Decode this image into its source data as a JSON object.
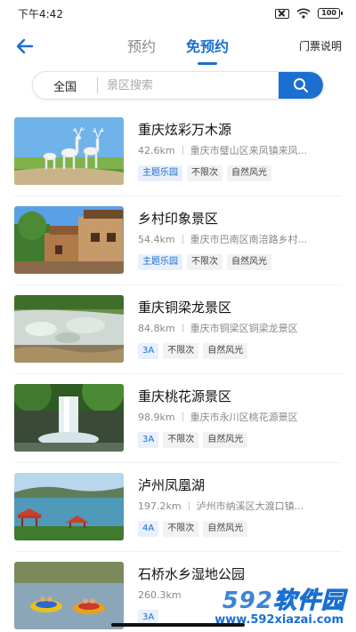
{
  "status_bar": {
    "time": "下午4:42",
    "battery": "100"
  },
  "nav": {
    "tabs": [
      {
        "label": "预约",
        "active": false
      },
      {
        "label": "免预约",
        "active": true
      }
    ],
    "ticket_info": "门票说明"
  },
  "search": {
    "region": "全国",
    "placeholder": "景区搜索"
  },
  "spots": [
    {
      "name": "重庆炫彩万木源",
      "distance": "42.6km",
      "address": "重庆市璧山区来凤镇来凤...",
      "tags": [
        "主题乐园",
        "不限次",
        "自然风光"
      ],
      "image": "deer-sculpture-park"
    },
    {
      "name": "乡村印象景区",
      "distance": "54.4km",
      "address": "重庆市巴南区南涪路乡村...",
      "tags": [
        "主题乐园",
        "不限次",
        "自然风光"
      ],
      "image": "village-houses"
    },
    {
      "name": "重庆铜梁龙景区",
      "distance": "84.8km",
      "address": "重庆市铜梁区铜梁龙景区",
      "tags": [
        "3A",
        "不限次",
        "自然风光"
      ],
      "image": "rocky-stream"
    },
    {
      "name": "重庆桃花源景区",
      "distance": "98.9km",
      "address": "重庆市永川区桃花源景区",
      "tags": [
        "3A",
        "不限次",
        "自然风光"
      ],
      "image": "waterfall"
    },
    {
      "name": "泸州凤凰湖",
      "distance": "197.2km",
      "address": "泸州市纳溪区大渡口镇...",
      "tags": [
        "4A",
        "不限次",
        "自然风光"
      ],
      "image": "lake-pavilion"
    },
    {
      "name": "石桥水乡湿地公园",
      "distance": "260.3km",
      "address": "",
      "tags": [
        "3A"
      ],
      "image": "bumper-boats"
    }
  ],
  "watermark": {
    "logo_num": "592",
    "logo_text": "软件园",
    "url": "www.592xiazai.com"
  },
  "colors": {
    "accent": "#1a6fd0",
    "tag_blue_bg": "#e8f0fb",
    "tag_gray_bg": "#f2f2f2"
  }
}
